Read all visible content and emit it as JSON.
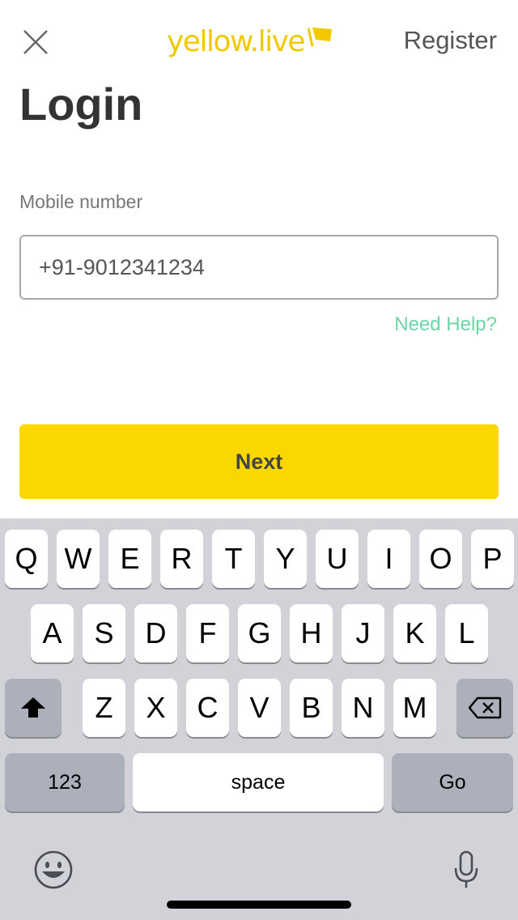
{
  "header": {
    "logo_text": "yellow.live",
    "register_label": "Register"
  },
  "page": {
    "title": "Login"
  },
  "form": {
    "mobile_label": "Mobile number",
    "mobile_value": "+91-9012341234",
    "help_link": "Need Help?",
    "next_label": "Next"
  },
  "keyboard": {
    "row1": [
      "Q",
      "W",
      "E",
      "R",
      "T",
      "Y",
      "U",
      "I",
      "O",
      "P"
    ],
    "row2": [
      "A",
      "S",
      "D",
      "F",
      "G",
      "H",
      "J",
      "K",
      "L"
    ],
    "row3": [
      "Z",
      "X",
      "C",
      "V",
      "B",
      "N",
      "M"
    ],
    "numbers_label": "123",
    "space_label": "space",
    "go_label": "Go"
  },
  "icons": {
    "close": "close-icon",
    "shift": "shift-icon",
    "backspace": "backspace-icon",
    "emoji": "emoji-icon",
    "mic": "microphone-icon"
  },
  "colors": {
    "brand_yellow": "#fbd700",
    "help_green": "#6fd6a3",
    "keyboard_bg": "#d1d3d9"
  }
}
